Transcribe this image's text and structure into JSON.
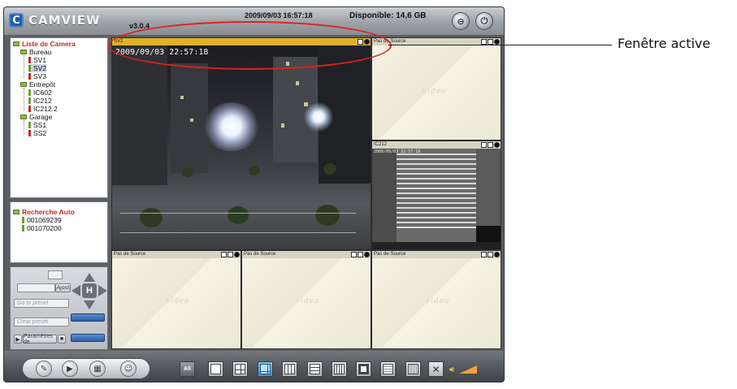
{
  "app": {
    "logo_text": "CAMVIEW",
    "logo_icon": "camera-c-icon",
    "version": "v3.0.4",
    "datetime": "2009/09/03 16:57:18",
    "disk": "Disponible: 14,6 GB"
  },
  "camera_tree": {
    "root": "Liste de Camera",
    "groups": [
      {
        "name": "Bureau",
        "cameras": [
          "SV1",
          "SV2",
          "SV3"
        ]
      },
      {
        "name": "Entrepôt",
        "cameras": [
          "IC602",
          "IC212",
          "IC212.2"
        ]
      },
      {
        "name": "Garage",
        "cameras": [
          "SS1",
          "SS2"
        ]
      }
    ],
    "selected": "SV2"
  },
  "auto_search": {
    "root": "Recherche Auto",
    "items": [
      "001069239",
      "001070200"
    ]
  },
  "ptz": {
    "add_label": "Ajout",
    "goto_preset": "Go to preset",
    "clear_preset": "Clear preset",
    "settings_label": "Paramètres de"
  },
  "video": {
    "cells": [
      {
        "id": "sv2",
        "title": "SV2",
        "active": true,
        "timestamp": "2009/09/03 22:57:18"
      },
      {
        "id": "top-right",
        "title": "Pas de Source"
      },
      {
        "id": "ic212",
        "title": "IC212",
        "timestamp": "2009/09/03 22:57:18"
      },
      {
        "id": "bottom-1",
        "title": "Pas de Source"
      },
      {
        "id": "bottom-2",
        "title": "Pas de Source"
      },
      {
        "id": "bottom-3",
        "title": "Pas de Source"
      }
    ],
    "placeholder_watermark": "video"
  },
  "toolbar": {
    "all_label": "All",
    "layout_labels": [
      "1",
      "4",
      "6",
      "9",
      "10",
      "13",
      "16",
      "25",
      "36"
    ]
  },
  "annotation": {
    "label": "Fenêtre active"
  },
  "colors": {
    "active_header": "#e0b128",
    "highlight": "#e02020",
    "tree_root": "#c62828"
  }
}
